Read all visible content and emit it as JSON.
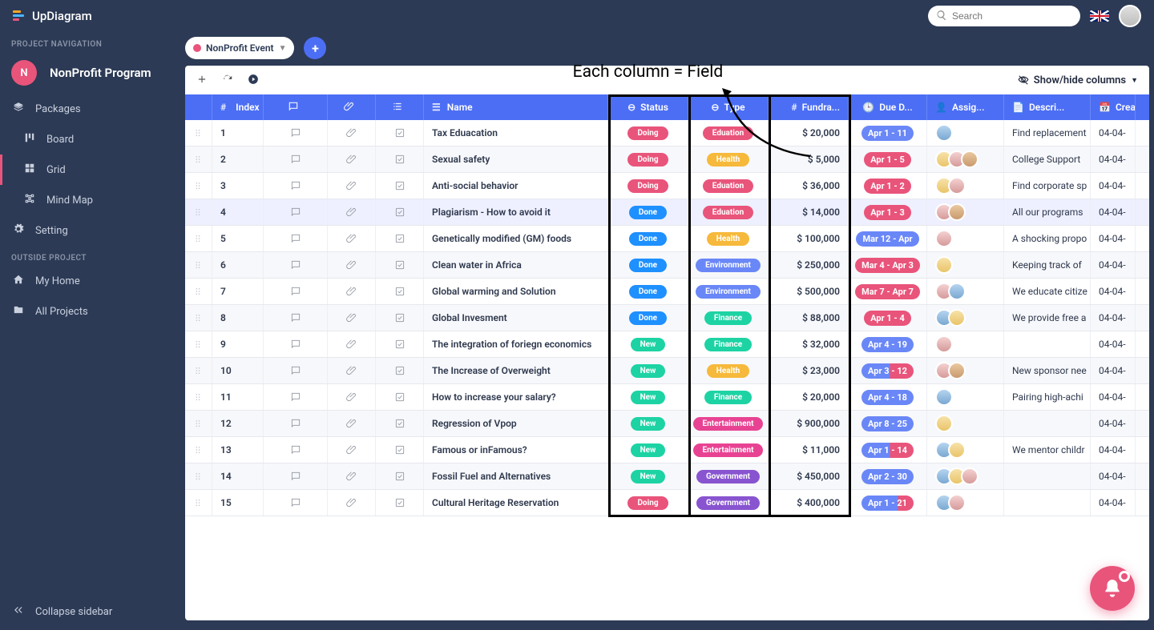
{
  "app": {
    "name": "UpDiagram"
  },
  "search": {
    "placeholder": "Search"
  },
  "annotation_label": "Each column = Field",
  "sidebar": {
    "section_nav": "PROJECT NAVIGATION",
    "project_initial": "N",
    "project_name": "NonProfit Program",
    "items": [
      {
        "label": "Packages"
      },
      {
        "label": "Board"
      },
      {
        "label": "Grid"
      },
      {
        "label": "Mind Map"
      },
      {
        "label": "Setting"
      }
    ],
    "section_outside": "OUTSIDE PROJECT",
    "outside": [
      {
        "label": "My Home"
      },
      {
        "label": "All Projects"
      }
    ],
    "collapse": "Collapse sidebar"
  },
  "tabs": {
    "selected": "NonProfit Event"
  },
  "toolbar": {
    "showhide": "Show/hide columns"
  },
  "columns": {
    "index": "Index",
    "name": "Name",
    "status": "Status",
    "type": "Type",
    "fund": "Fundra...",
    "due": "Due D...",
    "assign": "Assig...",
    "desc": "Descri...",
    "create": "Crea..."
  },
  "status_colors": {
    "Doing": "doing",
    "Done": "done",
    "New": "new"
  },
  "type_colors": {
    "Eduation": "eduation",
    "Health": "health",
    "Environment": "environment",
    "Finance": "finance",
    "Entertainment": "entertainment",
    "Government": "government"
  },
  "rows": [
    {
      "idx": "1",
      "name": "Tax Eduacation",
      "status": "Doing",
      "type": "Eduation",
      "fund": "$ 20,000",
      "due": "Apr 1 - 11",
      "due_cls": "blue",
      "assign": [
        "a4"
      ],
      "desc": "Find replacement",
      "create": "04-04-"
    },
    {
      "idx": "2",
      "name": "Sexual safety",
      "status": "Doing",
      "type": "Health",
      "fund": "$ 5,000",
      "due": "Apr 1 - 5",
      "due_cls": "pink",
      "assign": [
        "a3",
        "a2",
        "a1"
      ],
      "desc": "College Support",
      "create": "04-04-"
    },
    {
      "idx": "3",
      "name": "Anti-social behavior",
      "status": "Doing",
      "type": "Eduation",
      "fund": "$ 36,000",
      "due": "Apr 1 - 2",
      "due_cls": "pink",
      "assign": [
        "a3",
        "a2"
      ],
      "desc": "Find corporate sp",
      "create": "04-04-"
    },
    {
      "idx": "4",
      "name": "Plagiarism - How to avoid it",
      "status": "Done",
      "type": "Eduation",
      "fund": "$ 14,000",
      "due": "Apr 1 - 3",
      "due_cls": "pink",
      "assign": [
        "a2",
        "a1"
      ],
      "desc": "All our programs",
      "create": "04-04-",
      "hov": true
    },
    {
      "idx": "5",
      "name": "Genetically modified (GM) foods",
      "status": "Done",
      "type": "Health",
      "fund": "$ 100,000",
      "due": "Mar 12 - Apr",
      "due_cls": "blue",
      "assign": [
        "a2"
      ],
      "desc": "A shocking propo",
      "create": "04-04-"
    },
    {
      "idx": "6",
      "name": "Clean water in Africa",
      "status": "Done",
      "type": "Environment",
      "fund": "$ 250,000",
      "due": "Mar 4 - Apr 3",
      "due_cls": "pink",
      "assign": [
        "a3"
      ],
      "desc": "Keeping track of",
      "create": "04-04-"
    },
    {
      "idx": "7",
      "name": "Global warming and Solution",
      "status": "Done",
      "type": "Environment",
      "fund": "$ 500,000",
      "due": "Mar 7 - Apr 7",
      "due_cls": "pink",
      "assign": [
        "a2",
        "a4"
      ],
      "desc": "We educate citize",
      "create": "04-04-"
    },
    {
      "idx": "8",
      "name": "Global Invesment",
      "status": "Done",
      "type": "Finance",
      "fund": "$ 88,000",
      "due": "Apr 1 - 4",
      "due_cls": "pink",
      "assign": [
        "a4",
        "a3"
      ],
      "desc": "We provide free a",
      "create": "04-04-"
    },
    {
      "idx": "9",
      "name": "The integration of foriegn economics",
      "status": "New",
      "type": "Finance",
      "fund": "$ 32,000",
      "due": "Apr 4 - 19",
      "due_cls": "blue",
      "assign": [
        "a2"
      ],
      "desc": "",
      "create": "04-04-"
    },
    {
      "idx": "10",
      "name": "The Increase of Overweight",
      "status": "New",
      "type": "Health",
      "fund": "$ 23,000",
      "due": "Apr 3 - 12",
      "due_cls": "split",
      "assign": [
        "a2",
        "a1"
      ],
      "desc": "New sponsor nee",
      "create": "04-04-"
    },
    {
      "idx": "11",
      "name": "How to increase your salary?",
      "status": "New",
      "type": "Finance",
      "fund": "$ 20,000",
      "due": "Apr 4 - 18",
      "due_cls": "blue",
      "assign": [
        "a4"
      ],
      "desc": "Pairing high-achi",
      "create": "04-04-"
    },
    {
      "idx": "12",
      "name": "Regression of Vpop",
      "status": "New",
      "type": "Entertainment",
      "fund": "$ 900,000",
      "due": "Apr 8 - 25",
      "due_cls": "blue",
      "assign": [
        "a3"
      ],
      "desc": "",
      "create": "04-04-"
    },
    {
      "idx": "13",
      "name": "Famous or inFamous?",
      "status": "New",
      "type": "Entertainment",
      "fund": "$ 11,000",
      "due": "Apr 1 - 14",
      "due_cls": "split",
      "assign": [
        "a4",
        "a3"
      ],
      "desc": "We mentor childr",
      "create": "04-04-"
    },
    {
      "idx": "14",
      "name": "Fossil Fuel and Alternatives",
      "status": "New",
      "type": "Government",
      "fund": "$ 450,000",
      "due": "Apr 2 - 30",
      "due_cls": "blue",
      "assign": [
        "a4",
        "a3",
        "a2"
      ],
      "desc": "",
      "create": "04-04-"
    },
    {
      "idx": "15",
      "name": "Cultural Heritage Reservation",
      "status": "Doing",
      "type": "Government",
      "fund": "$ 400,000",
      "due": "Apr 1 - 21",
      "due_cls": "split2",
      "assign": [
        "a4",
        "a2"
      ],
      "desc": "",
      "create": "04-04-"
    }
  ]
}
